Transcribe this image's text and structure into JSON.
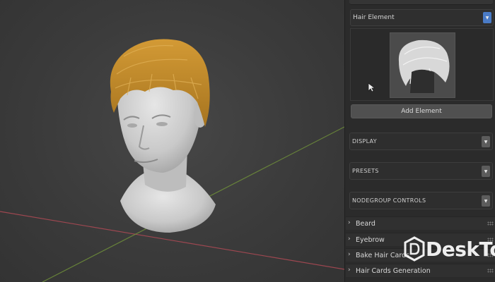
{
  "viewport": {
    "axis_colors": {
      "x_axis": "#b04a55",
      "y_axis": "#6f8f3a"
    },
    "hair_color": "#c08a2c",
    "skin_color": "#d8d8d8"
  },
  "panel": {
    "hair_element": {
      "label": "Hair Element",
      "icon": "chevron-down-icon"
    },
    "add_element_label": "Add Element",
    "sections": [
      {
        "label": "DISPLAY"
      },
      {
        "label": "PRESETS"
      },
      {
        "label": "NODEGROUP CONTROLS"
      }
    ],
    "sub_panels": [
      {
        "label": "Beard"
      },
      {
        "label": "Eyebrow"
      },
      {
        "label": "Bake Hair Cards"
      },
      {
        "label": "Hair Cards Generation"
      }
    ]
  },
  "watermark": {
    "text": "DeskTop",
    "logo_letter": "D"
  }
}
